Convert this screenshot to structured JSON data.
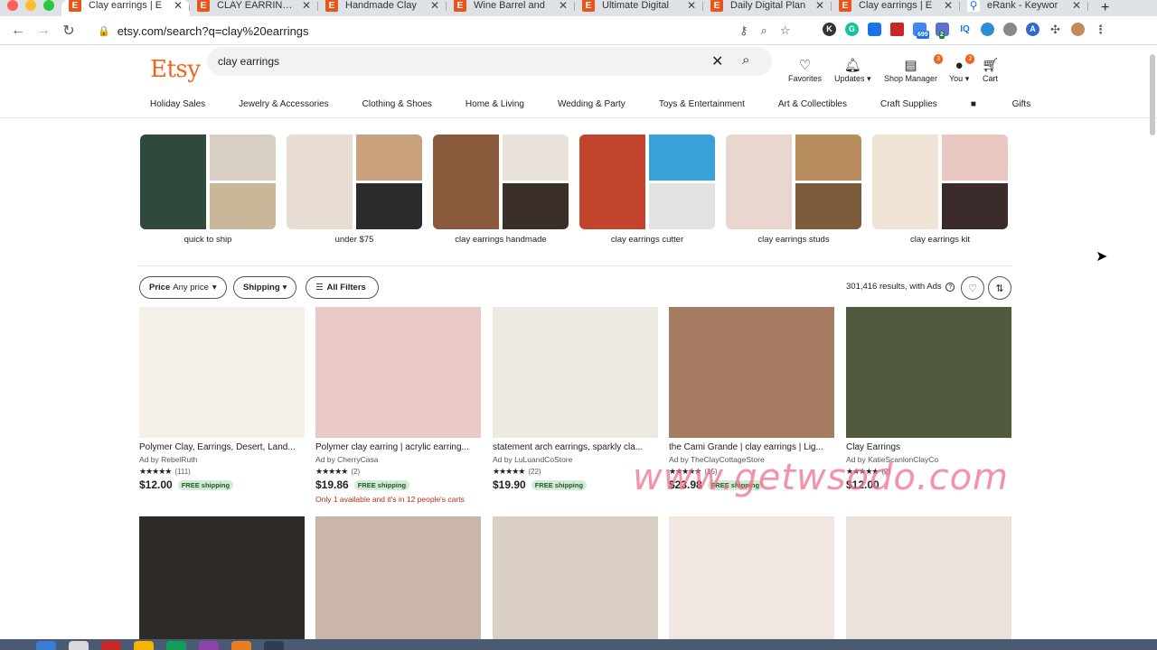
{
  "browser": {
    "tabs": [
      {
        "label": "Clay earrings | E",
        "favicon": "E",
        "active": true
      },
      {
        "label": "CLAY EARRINGS",
        "favicon": "E"
      },
      {
        "label": "Handmade Clay",
        "favicon": "E"
      },
      {
        "label": "Wine Barrel and",
        "favicon": "E"
      },
      {
        "label": "Ultimate Digital",
        "favicon": "E"
      },
      {
        "label": "Daily Digital Plan",
        "favicon": "E"
      },
      {
        "label": "Clay earrings | E",
        "favicon": "E"
      },
      {
        "label": "eRank - Keywor",
        "favicon": "⚲"
      }
    ],
    "url": "etsy.com/search?q=clay%20earrings",
    "extension_badges": [
      "699",
      "2"
    ]
  },
  "header": {
    "logo": "Etsy",
    "search_value": "clay earrings",
    "icons": [
      {
        "label": "Favorites",
        "icon": "heart-icon"
      },
      {
        "label": "Updates",
        "icon": "bell-icon"
      },
      {
        "label": "Shop Manager",
        "icon": "shop-icon",
        "badge": "3"
      },
      {
        "label": "You",
        "icon": "avatar-icon",
        "badge": "2"
      },
      {
        "label": "Cart",
        "icon": "cart-icon"
      }
    ]
  },
  "categories": [
    "Holiday Sales",
    "Jewelry & Accessories",
    "Clothing & Shoes",
    "Home & Living",
    "Wedding & Party",
    "Toys & Entertainment",
    "Art & Collectibles",
    "Craft Supplies",
    "Gifts"
  ],
  "related": [
    {
      "label": "quick to ship",
      "colors": [
        "#2f4a3a",
        "#d8cfc4",
        "#c9b79a"
      ]
    },
    {
      "label": "under $75",
      "colors": [
        "#e7ddd3",
        "#c9a27d",
        "#2b2b2b"
      ]
    },
    {
      "label": "clay earrings handmade",
      "colors": [
        "#8b5a3c",
        "#e8e2da",
        "#3b2f2a"
      ]
    },
    {
      "label": "clay earrings cutter",
      "colors": [
        "#c2442c",
        "#3aa0d8",
        "#e2e2e2"
      ]
    },
    {
      "label": "clay earrings studs",
      "colors": [
        "#e9d6cf",
        "#b98e5f",
        "#7b5b3a"
      ]
    },
    {
      "label": "clay earrings kit",
      "colors": [
        "#f0e4d6",
        "#e8c8c0",
        "#3b2b2b"
      ]
    }
  ],
  "filters": {
    "price_label": "Price",
    "price_value": "Any price",
    "shipping": "Shipping",
    "all_filters": "All Filters",
    "results": "301,416 results, with Ads"
  },
  "listings": [
    {
      "title": "Polymer Clay, Earrings, Desert, Land...",
      "ad": "Ad by RebelRuth",
      "stars": "★★★★★",
      "count": "(111)",
      "price": "$12.00",
      "ship": "FREE shipping",
      "note": "",
      "color": "#f5f1ea"
    },
    {
      "title": "Polymer clay earring | acrylic earring...",
      "ad": "Ad by CherryCasa",
      "stars": "★★★★★",
      "count": "(2)",
      "price": "$19.86",
      "ship": "FREE shipping",
      "note": "Only 1 available and it's in 12 people's carts",
      "color": "#e9c8c5"
    },
    {
      "title": "statement arch earrings, sparkly cla...",
      "ad": "Ad by LuLuandCoStore",
      "stars": "★★★★★",
      "count": "(22)",
      "price": "$19.90",
      "ship": "FREE shipping",
      "note": "",
      "color": "#efe9e3"
    },
    {
      "title": "the Cami Grande | clay earrings | Lig...",
      "ad": "Ad by TheClayCottageStore",
      "stars": "★★★★★",
      "count": "(15)",
      "price": "$23.98",
      "ship": "FREE shipping",
      "note": "",
      "color": "#a57c62"
    },
    {
      "title": "Clay Earrings",
      "ad": "Ad by KatieScanlonClayCo",
      "stars": "★★★★★",
      "count": "(2)",
      "price": "$12.00",
      "ship": "",
      "note": "",
      "color": "#4f5a3e"
    }
  ],
  "row2_colors": [
    "#2e2a26",
    "#c9b6a8",
    "#d9cfc2",
    "#f0e8e0",
    "#eae3dc"
  ],
  "watermark": "www.getwsodo.com"
}
